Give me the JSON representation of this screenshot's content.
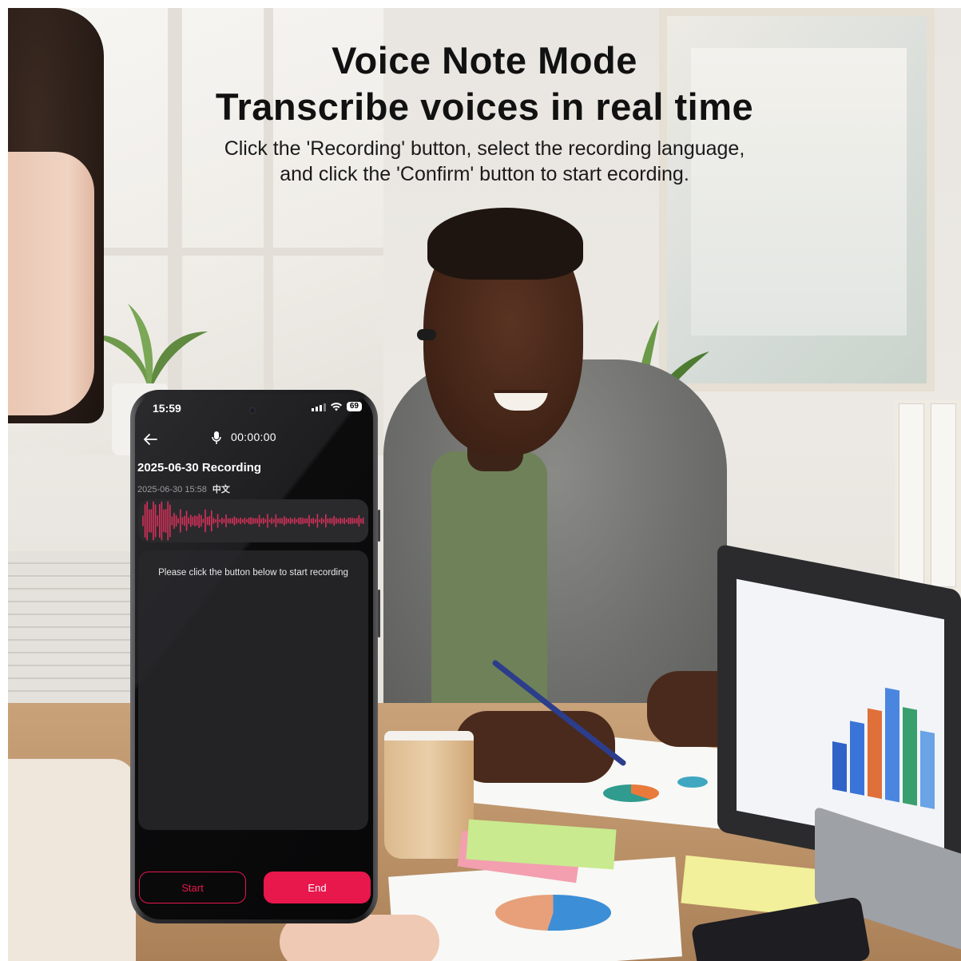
{
  "headline": {
    "title_line_1": "Voice Note Mode",
    "title_line_2": "Transcribe voices in real time",
    "description_line_1": "Click the 'Recording' button, select the recording language,",
    "description_line_2": "and click the 'Confirm' button to start ecording."
  },
  "phone": {
    "status_bar": {
      "time": "15:59",
      "battery": "69"
    },
    "header": {
      "timer": "00:00:00"
    },
    "recording": {
      "title": "2025-06-30  Recording",
      "datetime": "2025-06-30 15:58",
      "language": "中文"
    },
    "transcript": {
      "hint": "Please click the button below to start recording"
    },
    "buttons": {
      "start_label": "Start",
      "end_label": "End"
    }
  },
  "colors": {
    "accent": "#e8174c",
    "waveform": "#d9305a",
    "screen_background": "#0c0c0d"
  },
  "icons": [
    "back-arrow-icon",
    "microphone-icon",
    "signal-icon",
    "wifi-icon",
    "battery-icon"
  ]
}
